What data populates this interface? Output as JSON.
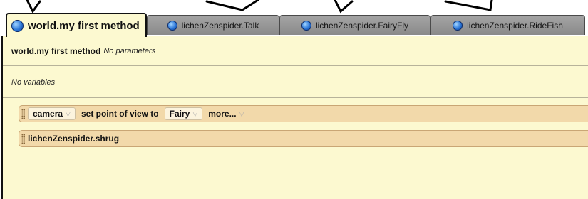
{
  "tabs": [
    {
      "label": "world.my first method",
      "active": true
    },
    {
      "label": "lichenZenspider.Talk",
      "active": false
    },
    {
      "label": "lichenZenspider.FairyFly",
      "active": false
    },
    {
      "label": "lichenZenspider.RideFish",
      "active": false
    }
  ],
  "method": {
    "name": "world.my first method",
    "parameters_note": "No parameters",
    "variables_note": "No variables"
  },
  "statements": [
    {
      "object": "camera",
      "action": "set point of view to",
      "target": "Fairy",
      "more": "more..."
    },
    {
      "call": "lichenZenspider.shrug"
    }
  ],
  "colors": {
    "editor_bg": "#fcf9d0",
    "statement_bg": "#f2d9aa",
    "tab_inactive": "#999999",
    "icon": "globe-icon"
  }
}
